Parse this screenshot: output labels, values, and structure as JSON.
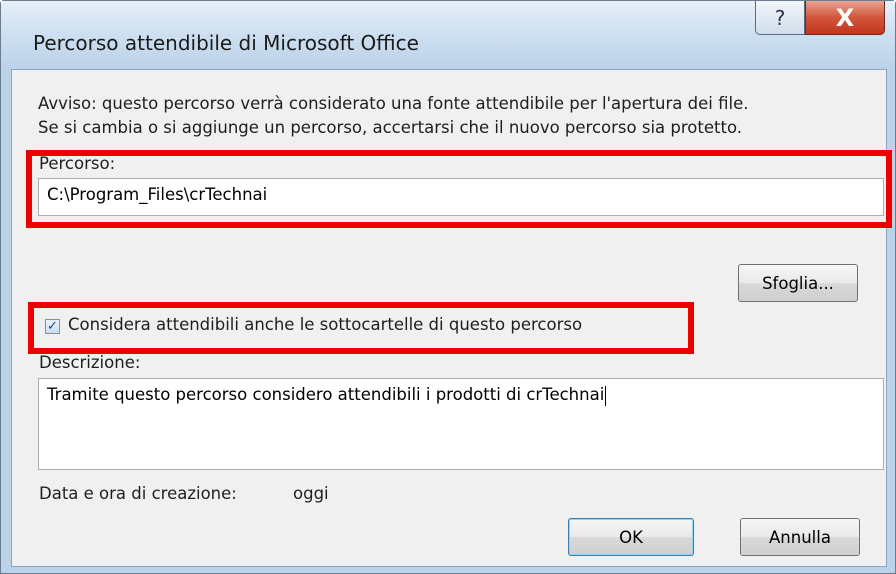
{
  "dialog": {
    "title": "Percorso attendibile di Microsoft Office",
    "help_glyph": "?",
    "close_glyph": "X"
  },
  "warning": {
    "line1": "Avviso: questo percorso verrà considerato una fonte attendibile per l'apertura dei file.",
    "line2": "Se si cambia o si aggiunge un percorso, accertarsi che il nuovo percorso sia protetto."
  },
  "path": {
    "label": "Percorso:",
    "value": "C:\\Program_Files\\crTechnai"
  },
  "browse_button": {
    "label": "Sfoglia..."
  },
  "subfolders": {
    "checked": true,
    "label": "Considera attendibili anche le sottocartelle di questo percorso"
  },
  "description": {
    "label": "Descrizione:",
    "value": "Tramite questo percorso considero attendibili i prodotti di crTechnai"
  },
  "created": {
    "label": "Data e ora di creazione:",
    "value": "oggi"
  },
  "ok_button": {
    "label": "OK"
  },
  "cancel_button": {
    "label": "Annulla"
  },
  "colors": {
    "highlight": "#ef0000",
    "title_bar": "#bcd2e9",
    "close_button": "#c0361d"
  }
}
